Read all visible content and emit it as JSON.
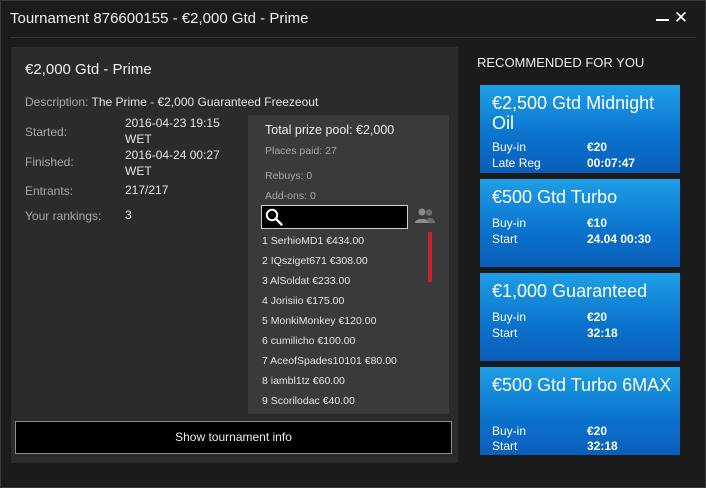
{
  "window": {
    "title": "Tournament 876600155 - €2,000 Gtd - Prime",
    "minimize_icon": "minimize-icon",
    "close_icon": "close-icon",
    "close_glyph": "✕"
  },
  "tournament": {
    "name": "€2,000 Gtd - Prime",
    "description_label": "Description:",
    "description_value": "The Prime - €2,000 Guaranteed Freezeout",
    "started_label": "Started:",
    "started_value": "2016-04-23 19:15 WET",
    "finished_label": "Finished:",
    "finished_value": "2016-04-24 00:27 WET",
    "entrants_label": "Entrants:",
    "entrants_value": "217/217",
    "rankings_label": "Your rankings:",
    "rankings_value": "3"
  },
  "prize": {
    "total_prize_pool": "Total prize pool: €2,000",
    "places_paid": "Places paid: 27",
    "rebuys": "Rebuys: 0",
    "addons": "Add-ons: 0",
    "search_placeholder": "",
    "rankings": [
      "1 SerhioMD1 €434.00",
      "2 IQsziget671 €308.00",
      "3 AlSoldat €233.00",
      "4 Jorisiio €175.00",
      "5 MonkiMonkey €120.00",
      "6 cumilicho €100.00",
      "7 AceofSpades10101 €80.00",
      "8 iambl1tz €60.00",
      "9 Scorilodac €40.00"
    ]
  },
  "actions": {
    "show_info": "Show tournament info"
  },
  "recommended": {
    "title": "RECOMMENDED FOR YOU",
    "cards": [
      {
        "name": "€2,500 Gtd Midnight Oil",
        "row1_label": "Buy-in",
        "row1_value": "€20",
        "row2_label": "Late Reg",
        "row2_value": "00:07:47"
      },
      {
        "name": "€500 Gtd Turbo",
        "row1_label": "Buy-in",
        "row1_value": "€10",
        "row2_label": "Start",
        "row2_value": "24.04 00:30"
      },
      {
        "name": "€1,000 Guaranteed",
        "row1_label": "Buy-in",
        "row1_value": "€20",
        "row2_label": "Start",
        "row2_value": "32:18"
      },
      {
        "name": "€500 Gtd Turbo 6MAX",
        "row1_label": "Buy-in",
        "row1_value": "€20",
        "row2_label": "Start",
        "row2_value": "32:18"
      }
    ]
  },
  "colors": {
    "accent_blue": "#0a72cc",
    "scrollbar_red": "#c4262e",
    "panel_bg": "#2b2b2b",
    "window_bg": "#1b1b1b"
  }
}
